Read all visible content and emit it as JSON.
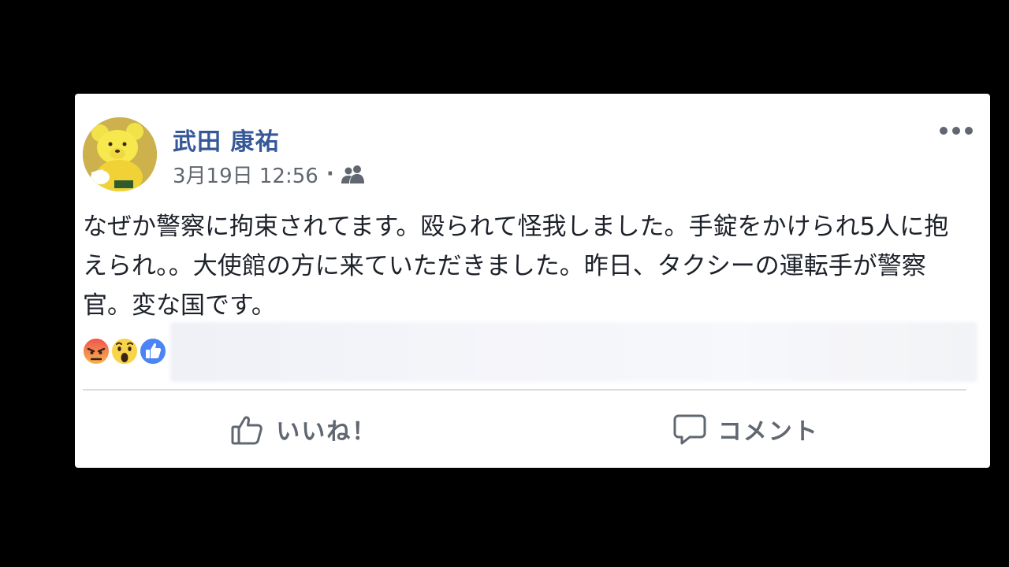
{
  "post": {
    "author_name": "武田 康祐",
    "timestamp": "3月19日 12:56",
    "separator": "·",
    "audience_icon": "friends-icon",
    "more_icon": "more-options-icon",
    "text": "なぜか警察に拘束されてます。殴られて怪我しました。手錠をかけられ5人に抱えられ。。大使館の方に来ていただきました。昨日、タクシーの運転手が警察官。変な国です。",
    "reactions": [
      "angry-reaction-icon",
      "wow-reaction-icon",
      "like-reaction-icon"
    ],
    "actions": {
      "like_label": "いいね！",
      "like_icon": "thumbs-up-icon",
      "comment_label": "コメント",
      "comment_icon": "speech-bubble-icon"
    }
  },
  "colors": {
    "author_name": "#365899",
    "meta_text": "#616770",
    "body_text": "#1d2129",
    "background": "#000000",
    "card": "#ffffff",
    "like_blue": "#4267b2",
    "angry_red": "#e9710f"
  }
}
